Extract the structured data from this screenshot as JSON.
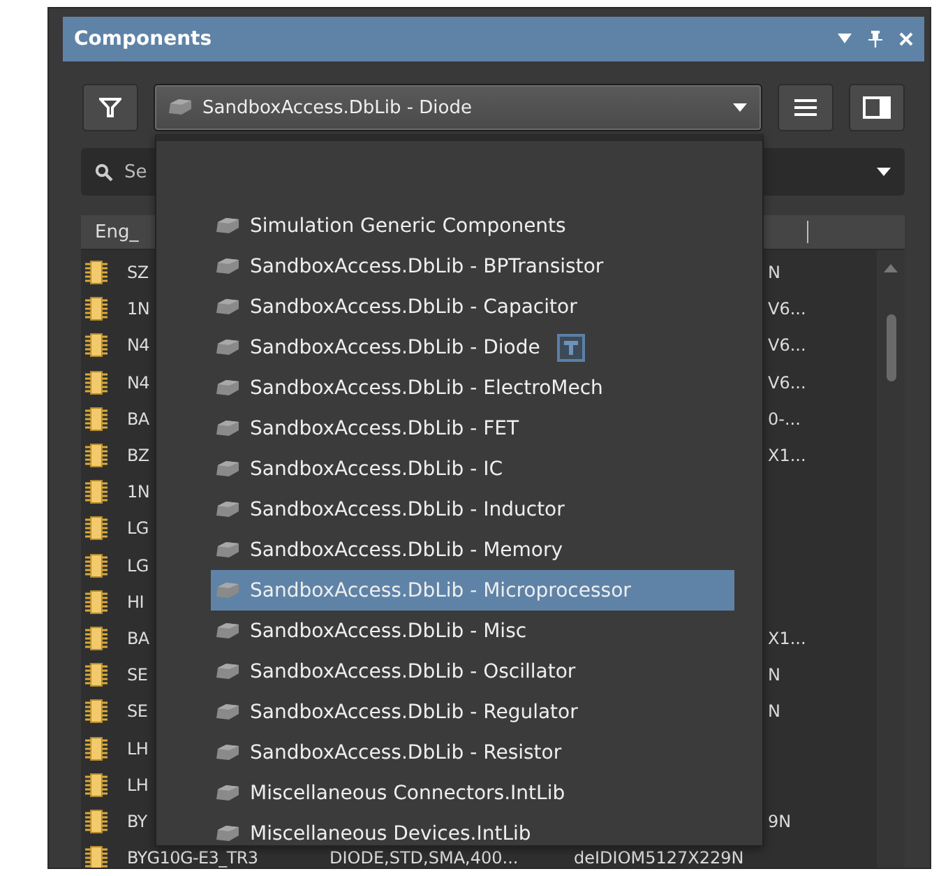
{
  "panel": {
    "title": "Components"
  },
  "library_select": {
    "value": "SandboxAccess.DbLib - Diode",
    "expanded": true
  },
  "search": {
    "placeholder": "Se"
  },
  "table": {
    "columns": [
      "Eng_"
    ],
    "rows": [
      {
        "name": "SZ",
        "tail": "N"
      },
      {
        "name": "1N",
        "tail": "V6..."
      },
      {
        "name": "N4",
        "tail": "V6..."
      },
      {
        "name": "N4",
        "tail": "V6..."
      },
      {
        "name": "BA",
        "tail": "0-..."
      },
      {
        "name": "BZ",
        "tail": "X1..."
      },
      {
        "name": "1N"
      },
      {
        "name": "LG"
      },
      {
        "name": "LG"
      },
      {
        "name": "HI"
      },
      {
        "name": "BA",
        "tail": "X1..."
      },
      {
        "name": "SE",
        "tail": "N"
      },
      {
        "name": "SE",
        "tail": "N"
      },
      {
        "name": "LH"
      },
      {
        "name": "LH"
      },
      {
        "name": "BY",
        "tail": "9N"
      },
      {
        "name": "BYG10G-E3_TR3",
        "description": "DIODE,STD,SMA,400...",
        "footprint": "deIDIOM5127X229N"
      }
    ]
  },
  "dropdown": {
    "items": [
      {
        "label": "Simulation Generic Components",
        "selected": false,
        "filtered": false
      },
      {
        "label": "SandboxAccess.DbLib - BPTransistor",
        "selected": false,
        "filtered": false
      },
      {
        "label": "SandboxAccess.DbLib - Capacitor",
        "selected": false,
        "filtered": false
      },
      {
        "label": "SandboxAccess.DbLib - Diode",
        "selected": false,
        "filtered": true
      },
      {
        "label": "SandboxAccess.DbLib - ElectroMech",
        "selected": false,
        "filtered": false
      },
      {
        "label": "SandboxAccess.DbLib - FET",
        "selected": false,
        "filtered": false
      },
      {
        "label": "SandboxAccess.DbLib - IC",
        "selected": false,
        "filtered": false
      },
      {
        "label": "SandboxAccess.DbLib - Inductor",
        "selected": false,
        "filtered": false
      },
      {
        "label": "SandboxAccess.DbLib - Memory",
        "selected": false,
        "filtered": false
      },
      {
        "label": "SandboxAccess.DbLib - Microprocessor",
        "selected": true,
        "filtered": false
      },
      {
        "label": "SandboxAccess.DbLib - Misc",
        "selected": false,
        "filtered": false
      },
      {
        "label": "SandboxAccess.DbLib - Oscillator",
        "selected": false,
        "filtered": false
      },
      {
        "label": "SandboxAccess.DbLib - Regulator",
        "selected": false,
        "filtered": false
      },
      {
        "label": "SandboxAccess.DbLib - Resistor",
        "selected": false,
        "filtered": false
      },
      {
        "label": "Miscellaneous Connectors.IntLib",
        "selected": false,
        "filtered": false
      },
      {
        "label": "Miscellaneous Devices.IntLib",
        "selected": false,
        "filtered": false
      }
    ]
  }
}
